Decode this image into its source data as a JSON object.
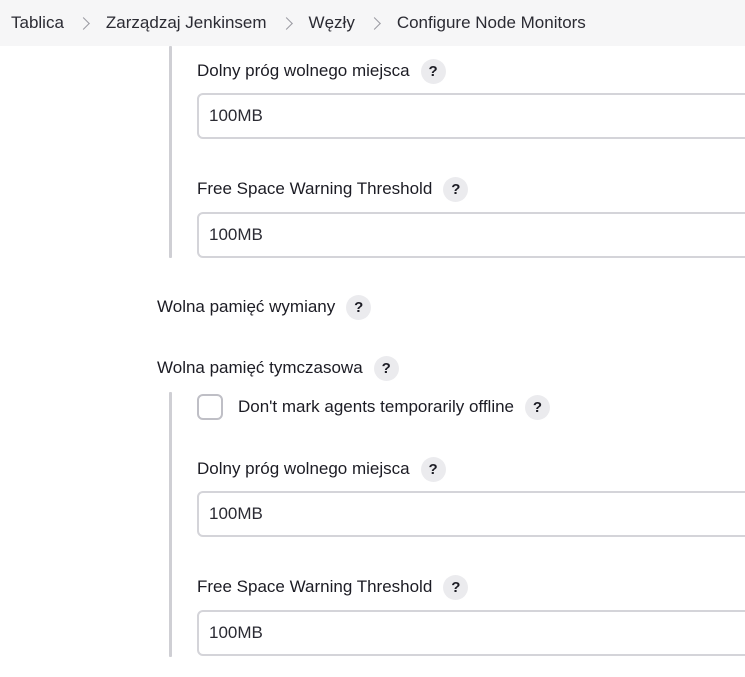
{
  "breadcrumb": {
    "items": [
      "Tablica",
      "Zarządzaj Jenkinsem",
      "Węzły",
      "Configure Node Monitors"
    ]
  },
  "section_top": {
    "threshold_label": "Dolny próg wolnego miejsca",
    "threshold_value": "100MB",
    "warning_label": "Free Space Warning Threshold",
    "warning_value": "100MB"
  },
  "swap_section": {
    "title": "Wolna pamięć wymiany"
  },
  "temp_section": {
    "title": "Wolna pamięć tymczasowa",
    "checkbox_label": "Don't mark agents temporarily offline",
    "threshold_label": "Dolny próg wolnego miejsca",
    "threshold_value": "100MB",
    "warning_label": "Free Space Warning Threshold",
    "warning_value": "100MB"
  },
  "help_glyph": "?"
}
